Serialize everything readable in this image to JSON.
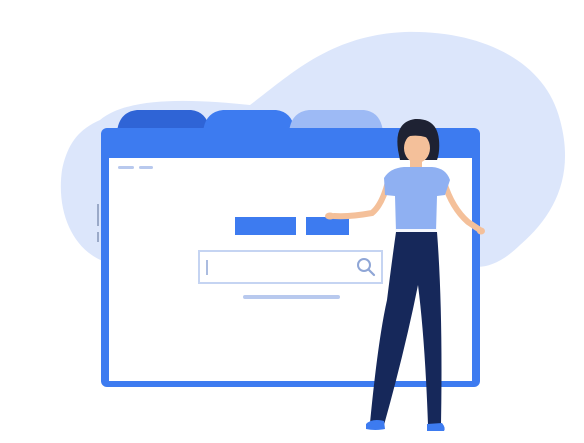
{
  "illustration": {
    "type": "browser-window-with-person",
    "colors": {
      "blob": "#dce6fb",
      "frame": "#3d7bf0",
      "tab_dark": "#2f64d6",
      "tab_mid": "#3d7bf0",
      "tab_light": "#9dbaf5",
      "content_bg": "#ffffff",
      "placeholder_bar": "#3d7bf0",
      "search_border": "#c5d4f2",
      "search_icon": "#8fa6d6",
      "hair": "#1e2233",
      "skin": "#f4c09a",
      "shirt": "#8fb0f2",
      "pants": "#16285a",
      "shoes": "#3d7bf0"
    },
    "search": {
      "placeholder": ""
    }
  }
}
